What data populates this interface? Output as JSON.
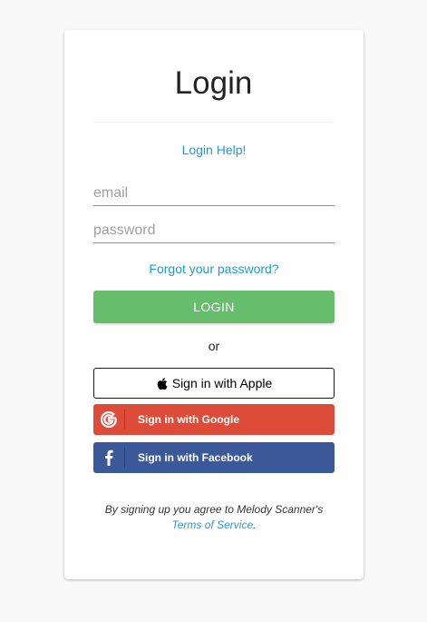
{
  "login": {
    "title": "Login",
    "help_link": "Login Help!",
    "email_placeholder": "email",
    "password_placeholder": "password",
    "forgot_link": "Forgot your password?",
    "login_button": "LOGIN",
    "or_text": "or",
    "apple_button": "Sign in with Apple",
    "google_button": "Sign in with Google",
    "facebook_button": "Sign in with Facebook",
    "terms_text": "By signing up you agree to Melody Scanner's",
    "terms_link": "Terms of Service",
    "terms_suffix": "."
  },
  "icons": {
    "apple": "apple-icon",
    "google": "google-icon",
    "facebook": "facebook-icon"
  },
  "colors": {
    "link": "#1e9bd6",
    "login_button": "#66bd6c",
    "google": "#dd4b39",
    "facebook": "#3b5998"
  }
}
